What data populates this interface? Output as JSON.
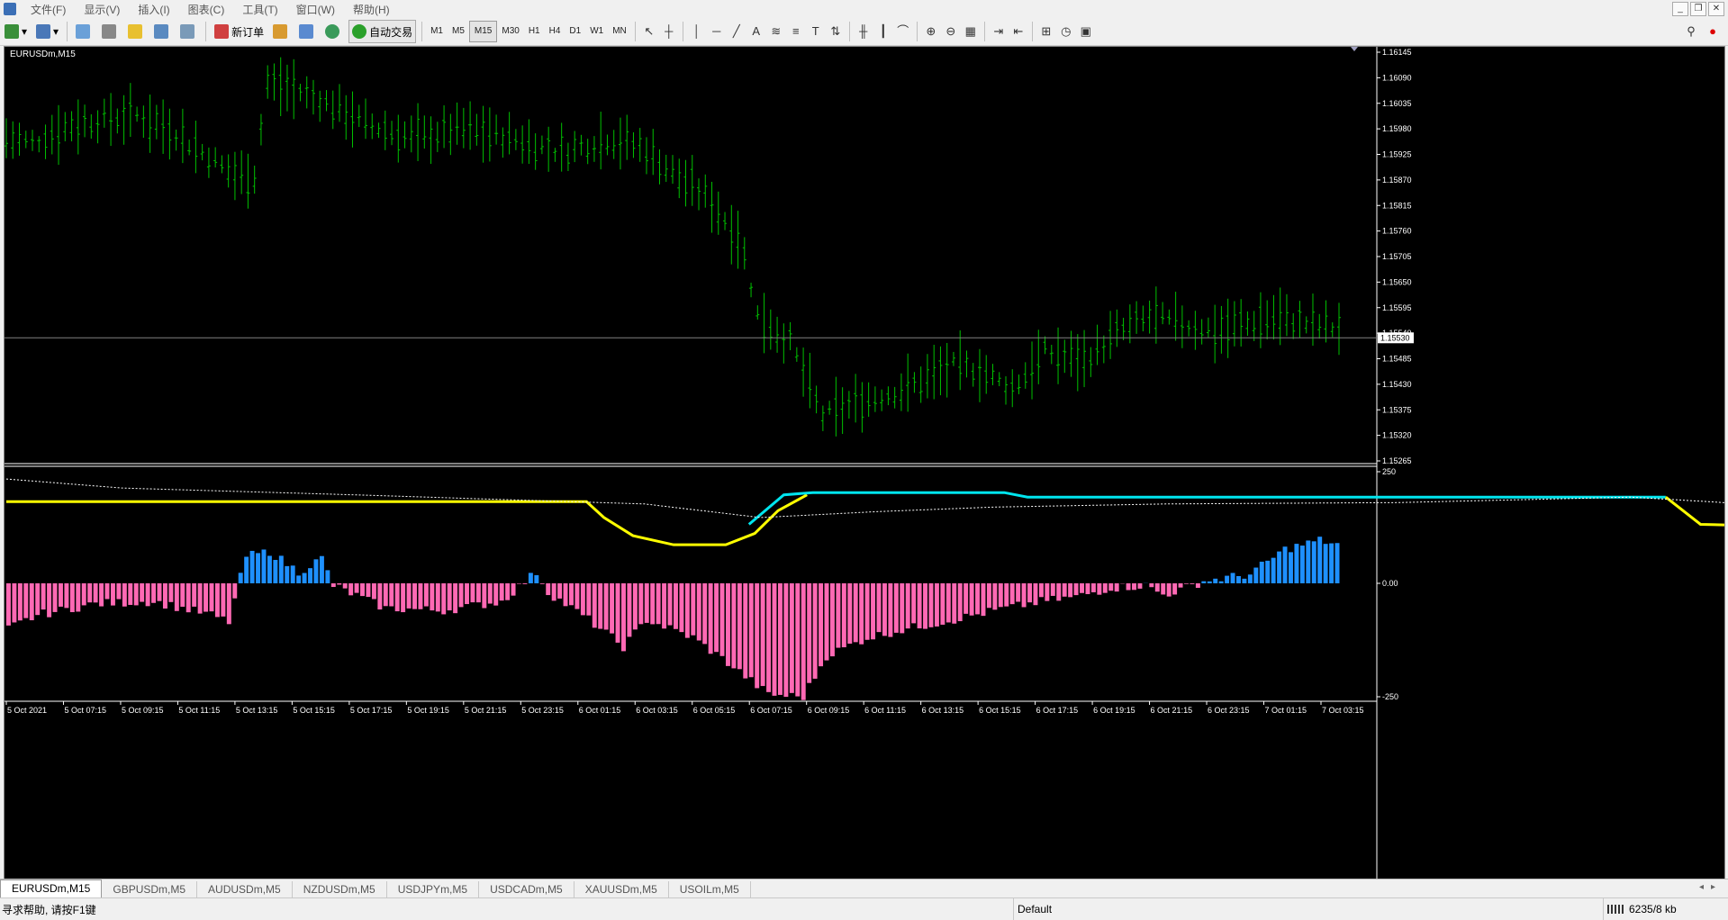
{
  "menu": [
    "文件(F)",
    "显示(V)",
    "插入(I)",
    "图表(C)",
    "工具(T)",
    "窗口(W)",
    "帮助(H)"
  ],
  "toolbar": {
    "new_order": "新订单",
    "auto_trade": "自动交易",
    "timeframes": [
      "M1",
      "M5",
      "M15",
      "M30",
      "H1",
      "H4",
      "D1",
      "W1",
      "MN"
    ],
    "active_timeframe": "M15",
    "text_tool": "A",
    "label_tool": "T"
  },
  "chart": {
    "symbol_label": "EURUSDm,M15",
    "current_price": "1.15530",
    "price_axis": [
      "1.16145",
      "1.16090",
      "1.16035",
      "1.15980",
      "1.15925",
      "1.15870",
      "1.15815",
      "1.15760",
      "1.15705",
      "1.15650",
      "1.15595",
      "1.15540",
      "1.15485",
      "1.15430",
      "1.15375",
      "1.15320",
      "1.15265"
    ],
    "indicator_axis": [
      "250",
      "0.00",
      "-250"
    ],
    "time_axis": [
      "5 Oct 2021",
      "5 Oct 07:15",
      "5 Oct 09:15",
      "5 Oct 11:15",
      "5 Oct 13:15",
      "5 Oct 15:15",
      "5 Oct 17:15",
      "5 Oct 19:15",
      "5 Oct 21:15",
      "5 Oct 23:15",
      "6 Oct 01:15",
      "6 Oct 03:15",
      "6 Oct 05:15",
      "6 Oct 07:15",
      "6 Oct 09:15",
      "6 Oct 11:15",
      "6 Oct 13:15",
      "6 Oct 15:15",
      "6 Oct 17:15",
      "6 Oct 19:15",
      "6 Oct 21:15",
      "6 Oct 23:15",
      "7 Oct 01:15",
      "7 Oct 03:15"
    ],
    "colors": {
      "bar": "#00c000",
      "hist_pos": "#1e90ff",
      "hist_neg": "#ff69b4",
      "line_yellow": "#ffff00",
      "line_cyan": "#00e5ee",
      "dotted": "#ffffff"
    }
  },
  "tabs": [
    "EURUSDm,M15",
    "GBPUSDm,M5",
    "AUDUSDm,M5",
    "NZDUSDm,M5",
    "USDJPYm,M5",
    "USDCADm,M5",
    "XAUUSDm,M5",
    "USOILm,M5"
  ],
  "active_tab": "EURUSDm,M15",
  "status": {
    "help": "寻求帮助, 请按F1键",
    "profile": "Default",
    "traffic": "6235/8 kb"
  }
}
